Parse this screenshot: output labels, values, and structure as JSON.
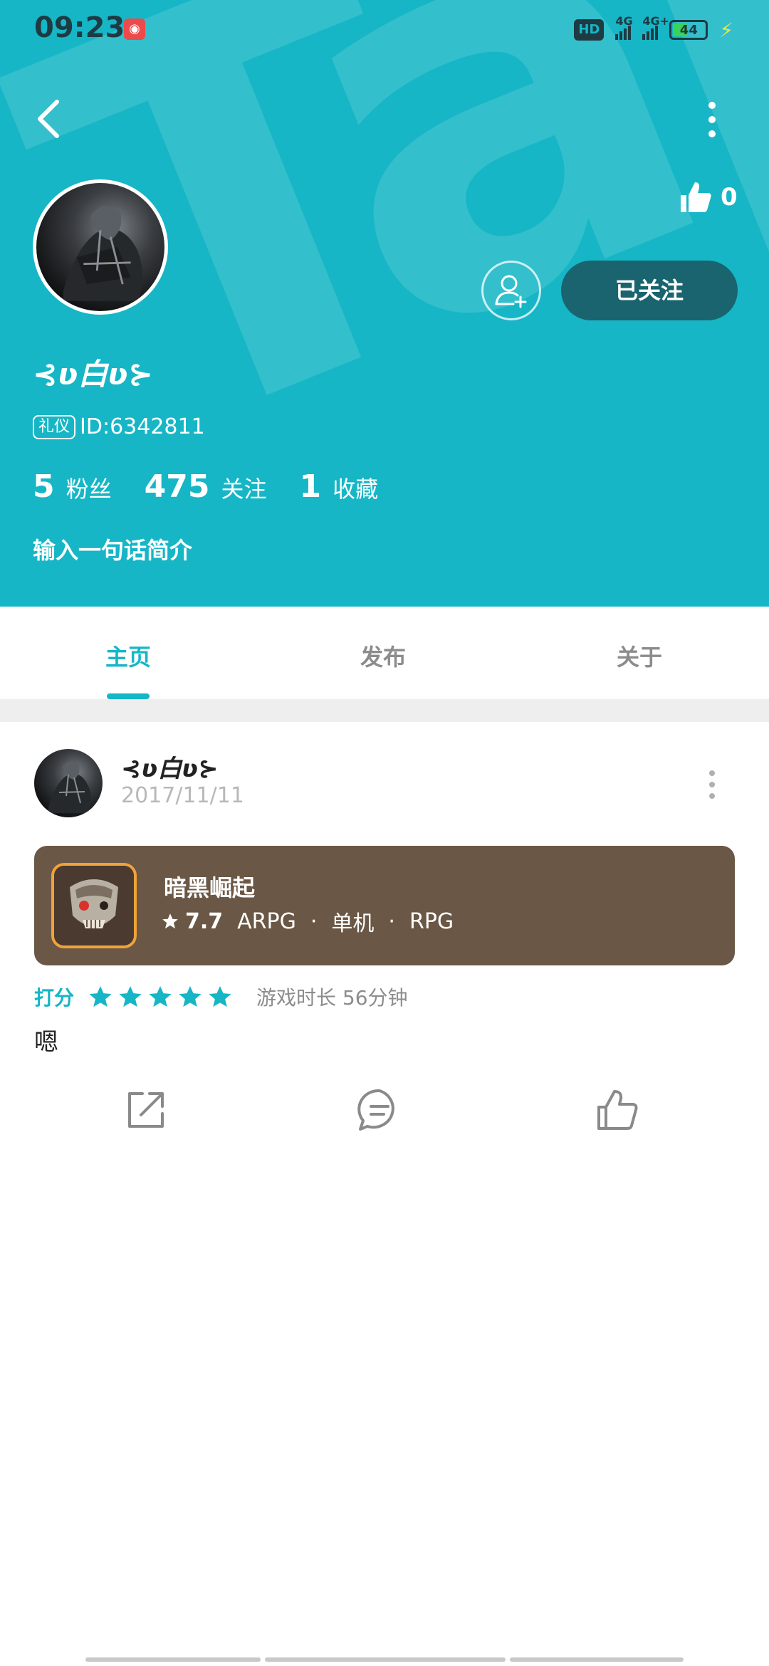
{
  "status_bar": {
    "time": "09:23",
    "hd_label": "HD",
    "signal1_label": "4G",
    "signal2_label": "4G+",
    "battery": "44"
  },
  "header": {
    "bg_color": "#16b6c6",
    "like_count": "0",
    "follow_label": "已关注",
    "username": "⊰ʋ白ʋ⊱",
    "id_tag": "礼仪",
    "user_id": "ID:6342811",
    "stats": [
      {
        "num": "5",
        "label": "粉丝"
      },
      {
        "num": "475",
        "label": "关注"
      },
      {
        "num": "1",
        "label": "收藏"
      }
    ],
    "bio": "输入一句话简介"
  },
  "tabs": [
    {
      "label": "主页",
      "active": true
    },
    {
      "label": "发布",
      "active": false
    },
    {
      "label": "关于",
      "active": false
    }
  ],
  "post": {
    "username": "⊰ʋ白ʋ⊱",
    "date": "2017/11/11",
    "game": {
      "name": "暗黑崛起",
      "score": "7.7",
      "tags": [
        "ARPG",
        "单机",
        "RPG"
      ]
    },
    "rating_label": "打分",
    "rating_stars": 5,
    "playtime": "游戏时长 56分钟",
    "text": "嗯"
  },
  "icons": [
    "back-icon",
    "more-icon",
    "thumb-up-icon",
    "add-friend-icon",
    "star-icon",
    "share-icon",
    "comment-icon",
    "like-icon"
  ]
}
